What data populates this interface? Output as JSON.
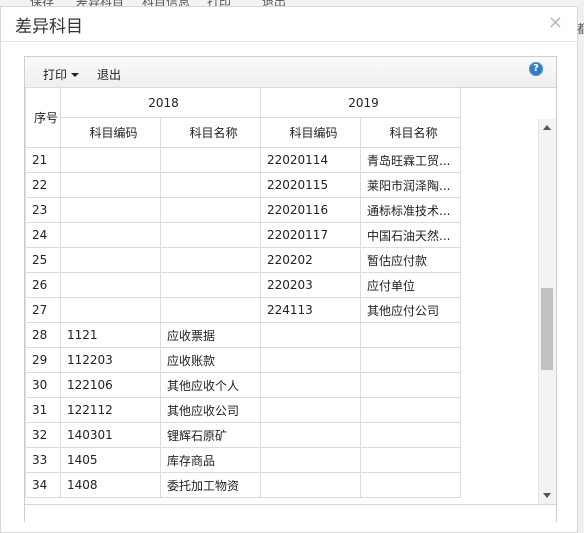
{
  "background": {
    "menu_items": [
      "保存",
      "差异科目",
      "科目信息",
      "打印",
      "退出"
    ],
    "right_edge_text": "都"
  },
  "dialog": {
    "title": "差异科目",
    "close_label": "×"
  },
  "toolbar": {
    "print_label": "打印",
    "exit_label": "退出",
    "help_label": "?"
  },
  "grid": {
    "header": {
      "seq": "序号",
      "year_a": "2018",
      "year_b": "2019",
      "code_a": "科目编码",
      "name_a": "科目名称",
      "code_b": "科目编码",
      "name_b": "科目名称"
    },
    "rows": [
      {
        "seq": "21",
        "code_a": "",
        "name_a": "",
        "code_b": "22020114",
        "name_b": "青岛旺霖工贸..."
      },
      {
        "seq": "22",
        "code_a": "",
        "name_a": "",
        "code_b": "22020115",
        "name_b": "莱阳市润泽陶..."
      },
      {
        "seq": "23",
        "code_a": "",
        "name_a": "",
        "code_b": "22020116",
        "name_b": "通标标准技术..."
      },
      {
        "seq": "24",
        "code_a": "",
        "name_a": "",
        "code_b": "22020117",
        "name_b": "中国石油天然..."
      },
      {
        "seq": "25",
        "code_a": "",
        "name_a": "",
        "code_b": "220202",
        "name_b": "暂估应付款"
      },
      {
        "seq": "26",
        "code_a": "",
        "name_a": "",
        "code_b": "220203",
        "name_b": "应付单位"
      },
      {
        "seq": "27",
        "code_a": "",
        "name_a": "",
        "code_b": "224113",
        "name_b": "其他应付公司"
      },
      {
        "seq": "28",
        "code_a": "1121",
        "name_a": "应收票据",
        "code_b": "",
        "name_b": ""
      },
      {
        "seq": "29",
        "code_a": "112203",
        "name_a": "应收账款",
        "code_b": "",
        "name_b": ""
      },
      {
        "seq": "30",
        "code_a": "122106",
        "name_a": "其他应收个人",
        "code_b": "",
        "name_b": ""
      },
      {
        "seq": "31",
        "code_a": "122112",
        "name_a": "其他应收公司",
        "code_b": "",
        "name_b": ""
      },
      {
        "seq": "32",
        "code_a": "140301",
        "name_a": "锂辉石原矿",
        "code_b": "",
        "name_b": ""
      },
      {
        "seq": "33",
        "code_a": "1405",
        "name_a": "库存商品",
        "code_b": "",
        "name_b": ""
      },
      {
        "seq": "34",
        "code_a": "1408",
        "name_a": "委托加工物资",
        "code_b": "",
        "name_b": ""
      }
    ]
  }
}
